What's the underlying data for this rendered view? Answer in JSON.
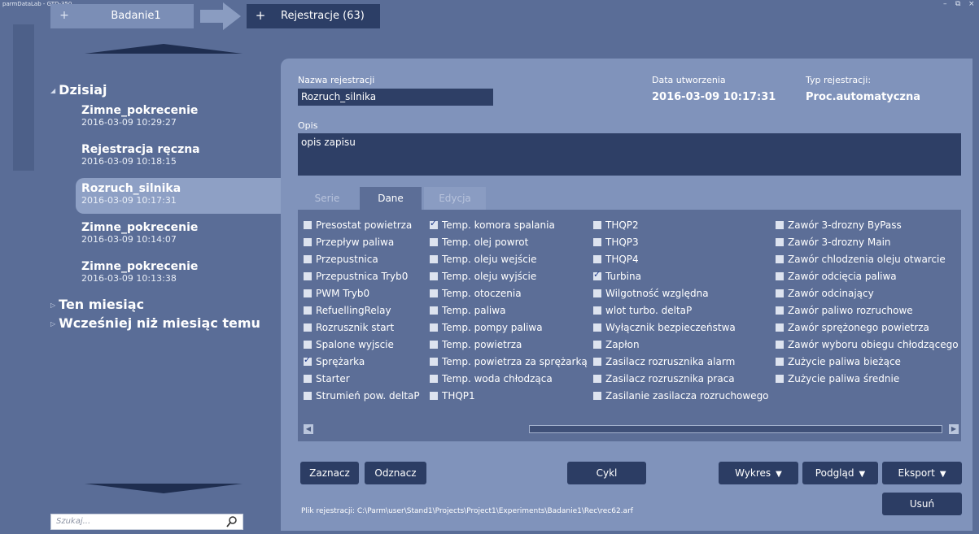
{
  "window": {
    "title": "parmDataLab - GTD-350",
    "controls": [
      "–",
      "⧉",
      "×"
    ]
  },
  "top_tabs": {
    "plus1": "+",
    "project_tab": "Badanie1",
    "plus2": "+",
    "registrations_tab": "Rejestracje (63)"
  },
  "sidebar": {
    "groups": [
      {
        "label": "Dzisiaj",
        "expanded": true
      },
      {
        "label": "Ten miesiąc",
        "expanded": false
      },
      {
        "label": "Wcześniej niż miesiąc temu",
        "expanded": false
      }
    ],
    "items": [
      {
        "name": "Zimne_pokrecenie",
        "date": "2016-03-09 10:29:27"
      },
      {
        "name": "Rejestracja ręczna",
        "date": "2016-03-09 10:18:15"
      },
      {
        "name": "Rozruch_silnika",
        "date": "2016-03-09 10:17:31",
        "selected": true
      },
      {
        "name": "Zimne_pokrecenie",
        "date": "2016-03-09 10:14:07"
      },
      {
        "name": "Zimne_pokrecenie",
        "date": "2016-03-09 10:13:38"
      }
    ],
    "search_placeholder": "Szukaj..."
  },
  "details": {
    "name_label": "Nazwa rejestracji",
    "name_value": "Rozruch_silnika",
    "date_label": "Data utworzenia",
    "date_value": "2016-03-09 10:17:31",
    "type_label": "Typ rejestracji:",
    "type_value": "Proc.automatyczna",
    "desc_label": "Opis",
    "desc_value": "opis zapisu"
  },
  "tabs": [
    "Serie",
    "Dane",
    "Edycja"
  ],
  "active_tab": "Dane",
  "channels": {
    "col1": [
      {
        "label": "Presostat powietrza",
        "checked": false
      },
      {
        "label": "Przepływ paliwa",
        "checked": false
      },
      {
        "label": "Przepustnica",
        "checked": false
      },
      {
        "label": "Przepustnica Tryb0",
        "checked": false
      },
      {
        "label": "PWM Tryb0",
        "checked": false
      },
      {
        "label": "RefuellingRelay",
        "checked": false
      },
      {
        "label": "Rozrusznik start",
        "checked": false
      },
      {
        "label": "Spalone wyjscie",
        "checked": false
      },
      {
        "label": "Sprężarka",
        "checked": true
      },
      {
        "label": "Starter",
        "checked": false
      },
      {
        "label": "Strumień pow. deltaP",
        "checked": false
      }
    ],
    "col2": [
      {
        "label": "Temp. komora spalania",
        "checked": true
      },
      {
        "label": "Temp. olej powrot",
        "checked": false
      },
      {
        "label": "Temp. oleju wejście",
        "checked": false
      },
      {
        "label": "Temp. oleju wyjście",
        "checked": false
      },
      {
        "label": "Temp. otoczenia",
        "checked": false
      },
      {
        "label": "Temp. paliwa",
        "checked": false
      },
      {
        "label": "Temp. pompy paliwa",
        "checked": false
      },
      {
        "label": "Temp. powietrza",
        "checked": false
      },
      {
        "label": "Temp. powietrza za sprężarką",
        "checked": false
      },
      {
        "label": "Temp. woda chłodząca",
        "checked": false
      },
      {
        "label": "THQP1",
        "checked": false
      }
    ],
    "col3": [
      {
        "label": "THQP2",
        "checked": false
      },
      {
        "label": "THQP3",
        "checked": false
      },
      {
        "label": "THQP4",
        "checked": false
      },
      {
        "label": "Turbina",
        "checked": true
      },
      {
        "label": "Wilgotność względna",
        "checked": false
      },
      {
        "label": "wlot turbo. deltaP",
        "checked": false
      },
      {
        "label": "Wyłącznik bezpieczeństwa",
        "checked": false
      },
      {
        "label": "Zapłon",
        "checked": false
      },
      {
        "label": "Zasilacz rozrusznika alarm",
        "checked": false
      },
      {
        "label": "Zasilacz rozrusznika praca",
        "checked": false
      },
      {
        "label": "Zasilanie zasilacza rozruchowego",
        "checked": false
      }
    ],
    "col4": [
      {
        "label": "Zawór 3-drozny ByPass",
        "checked": false
      },
      {
        "label": "Zawór 3-drozny Main",
        "checked": false
      },
      {
        "label": "Zawór chlodzenia oleju otwarcie",
        "checked": false
      },
      {
        "label": "Zawór odcięcia paliwa",
        "checked": false
      },
      {
        "label": "Zawór odcinający",
        "checked": false
      },
      {
        "label": "Zawór paliwo rozruchowe",
        "checked": false
      },
      {
        "label": "Zawór sprężonego powietrza",
        "checked": false
      },
      {
        "label": "Zawór wyboru obiegu chłodzącego",
        "checked": false
      },
      {
        "label": "Zużycie paliwa bieżące",
        "checked": false
      },
      {
        "label": "Zużycie paliwa średnie",
        "checked": false
      }
    ]
  },
  "buttons": {
    "select": "Zaznacz",
    "deselect": "Odznacz",
    "cycle": "Cykl",
    "chart": "Wykres",
    "preview": "Podgląd",
    "export": "Eksport",
    "delete": "Usuń"
  },
  "file_path": "Plik rejestracji: C:\\Parm\\user\\Stand1\\Projects\\Project1\\Experiments\\Badanie1\\Rec\\rec62.arf",
  "colors": {
    "background": "#5a6d97",
    "panel": "#8093bb",
    "dark": "#2c3e66",
    "selected": "#8ea0c5"
  }
}
